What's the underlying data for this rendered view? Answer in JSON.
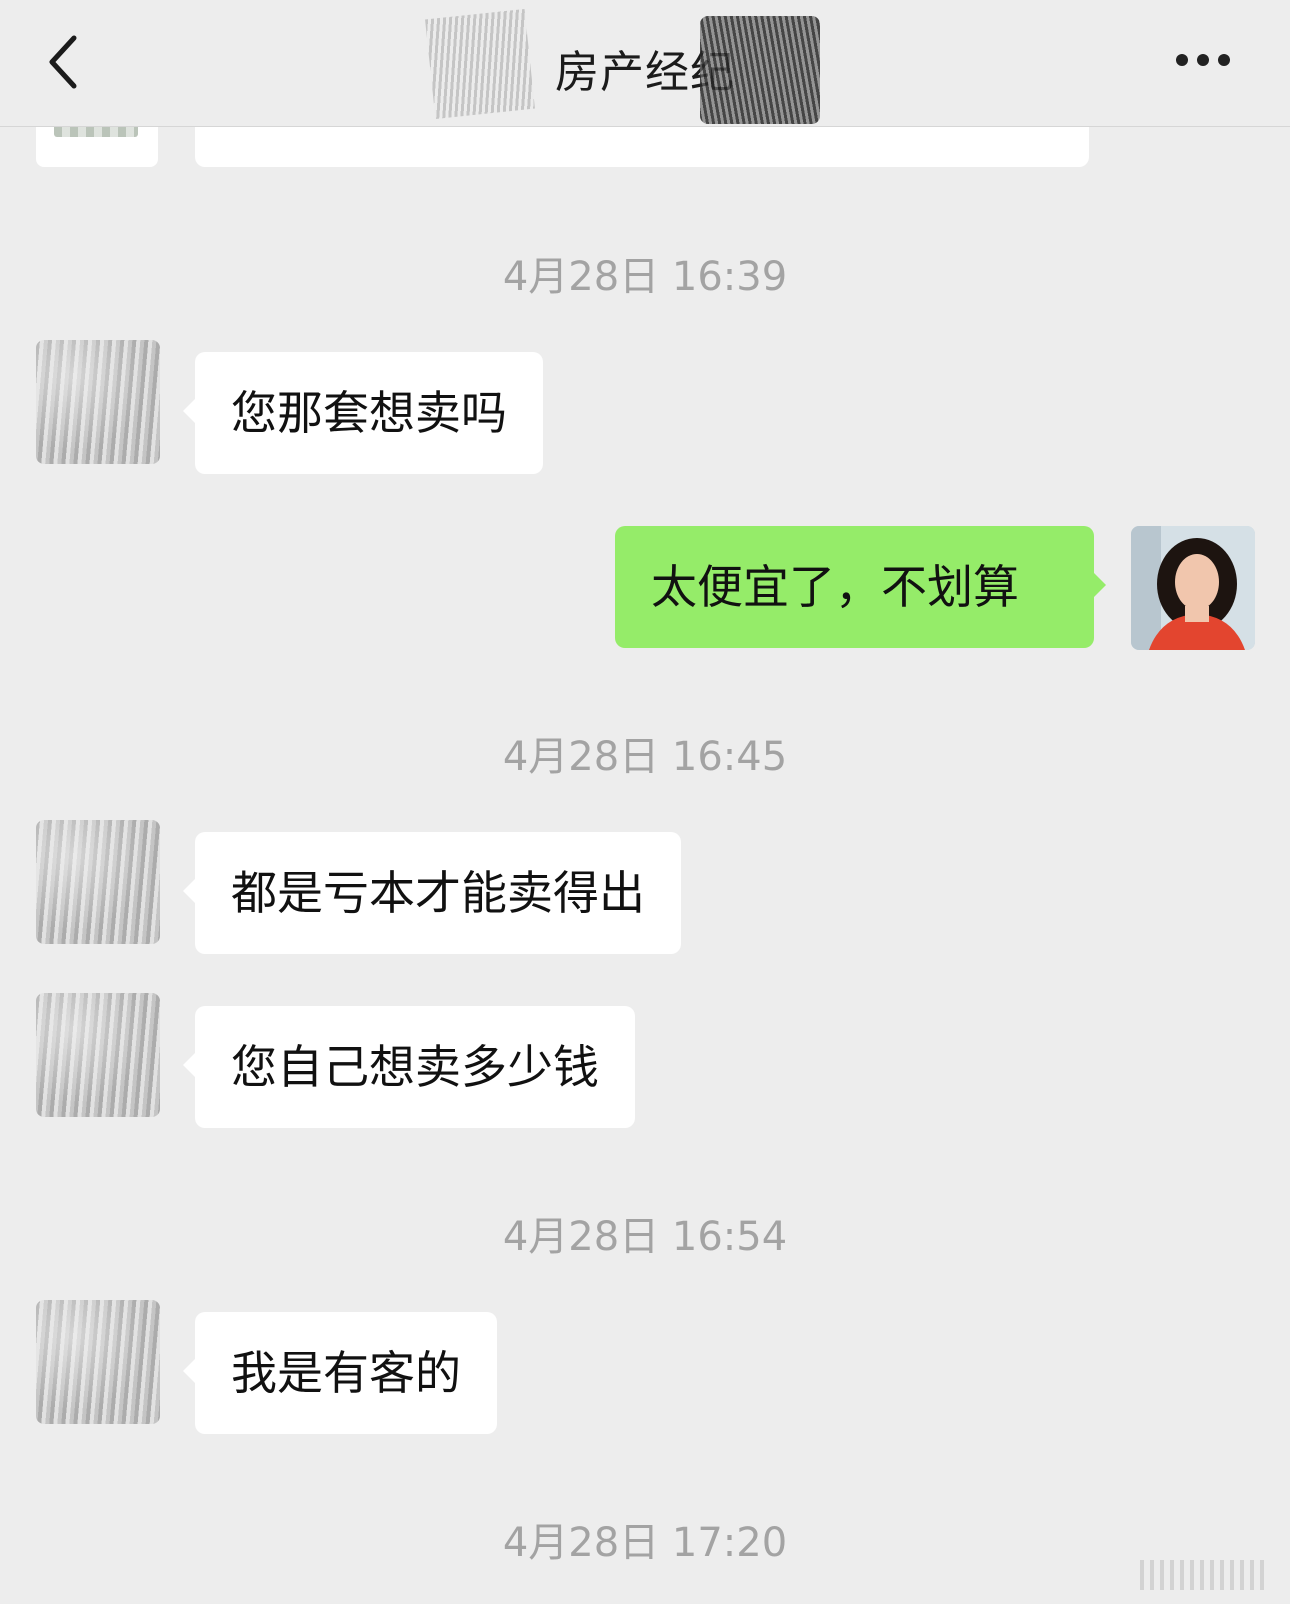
{
  "header": {
    "title": "房产经纪",
    "back_icon": "chevron-left-icon",
    "more_icon": "more-dots-icon"
  },
  "messages": [
    {
      "type": "time",
      "text": "4月28日 16:39"
    },
    {
      "type": "incoming",
      "text": "您那套想卖吗"
    },
    {
      "type": "outgoing",
      "text": "太便宜了，不划算"
    },
    {
      "type": "time",
      "text": "4月28日 16:45"
    },
    {
      "type": "incoming",
      "text": "都是亏本才能卖得出"
    },
    {
      "type": "incoming",
      "text": "您自己想卖多少钱"
    },
    {
      "type": "time",
      "text": "4月28日 16:54"
    },
    {
      "type": "incoming",
      "text": "我是有客的"
    },
    {
      "type": "time",
      "text": "4月28日 17:20"
    }
  ],
  "colors": {
    "background": "#ededed",
    "incoming_bubble": "#ffffff",
    "outgoing_bubble": "#95ec69",
    "timestamp": "#a3a3a3"
  }
}
